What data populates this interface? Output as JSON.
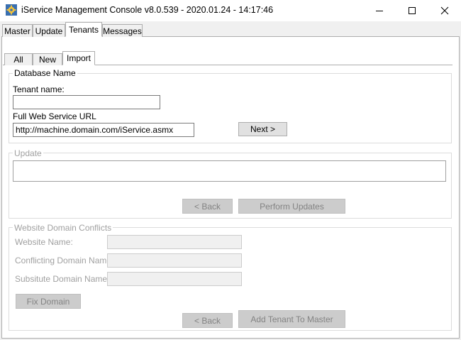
{
  "window": {
    "title": "iService Management Console v8.0.539 - 2020.01.24 - 14:17:46",
    "minimize_icon": "minimize-icon",
    "maximize_icon": "maximize-icon",
    "close_icon": "close-icon"
  },
  "main_tabs": [
    "Master",
    "Update",
    "Tenants",
    "Messages"
  ],
  "selected_main_tab": "Tenants",
  "sub_tabs": [
    "All",
    "New",
    "Import"
  ],
  "selected_sub_tab": "Import",
  "database": {
    "legend": "Database Name",
    "tenant_name_label": "Tenant name:",
    "tenant_name_value": "",
    "url_label": "Full Web Service URL",
    "url_value": "http://machine.domain.com/iService.asmx",
    "next_button": "Next >"
  },
  "update": {
    "legend": "Update",
    "text": "",
    "back_button": "< Back",
    "perform_button": "Perform Updates"
  },
  "conflicts": {
    "legend": "Website Domain Conflicts",
    "website_name_label": "Website Name:",
    "conflicting_label": "Conflicting Domain Name:",
    "substitute_label": "Subsitute Domain Name:",
    "fix_button": "Fix Domain",
    "back_button": "< Back",
    "add_button": "Add Tenant To Master"
  },
  "colors": {
    "window_bg": "#f0f0f0",
    "panel_bg": "#ffffff",
    "disabled_text": "#a0a0a0"
  }
}
